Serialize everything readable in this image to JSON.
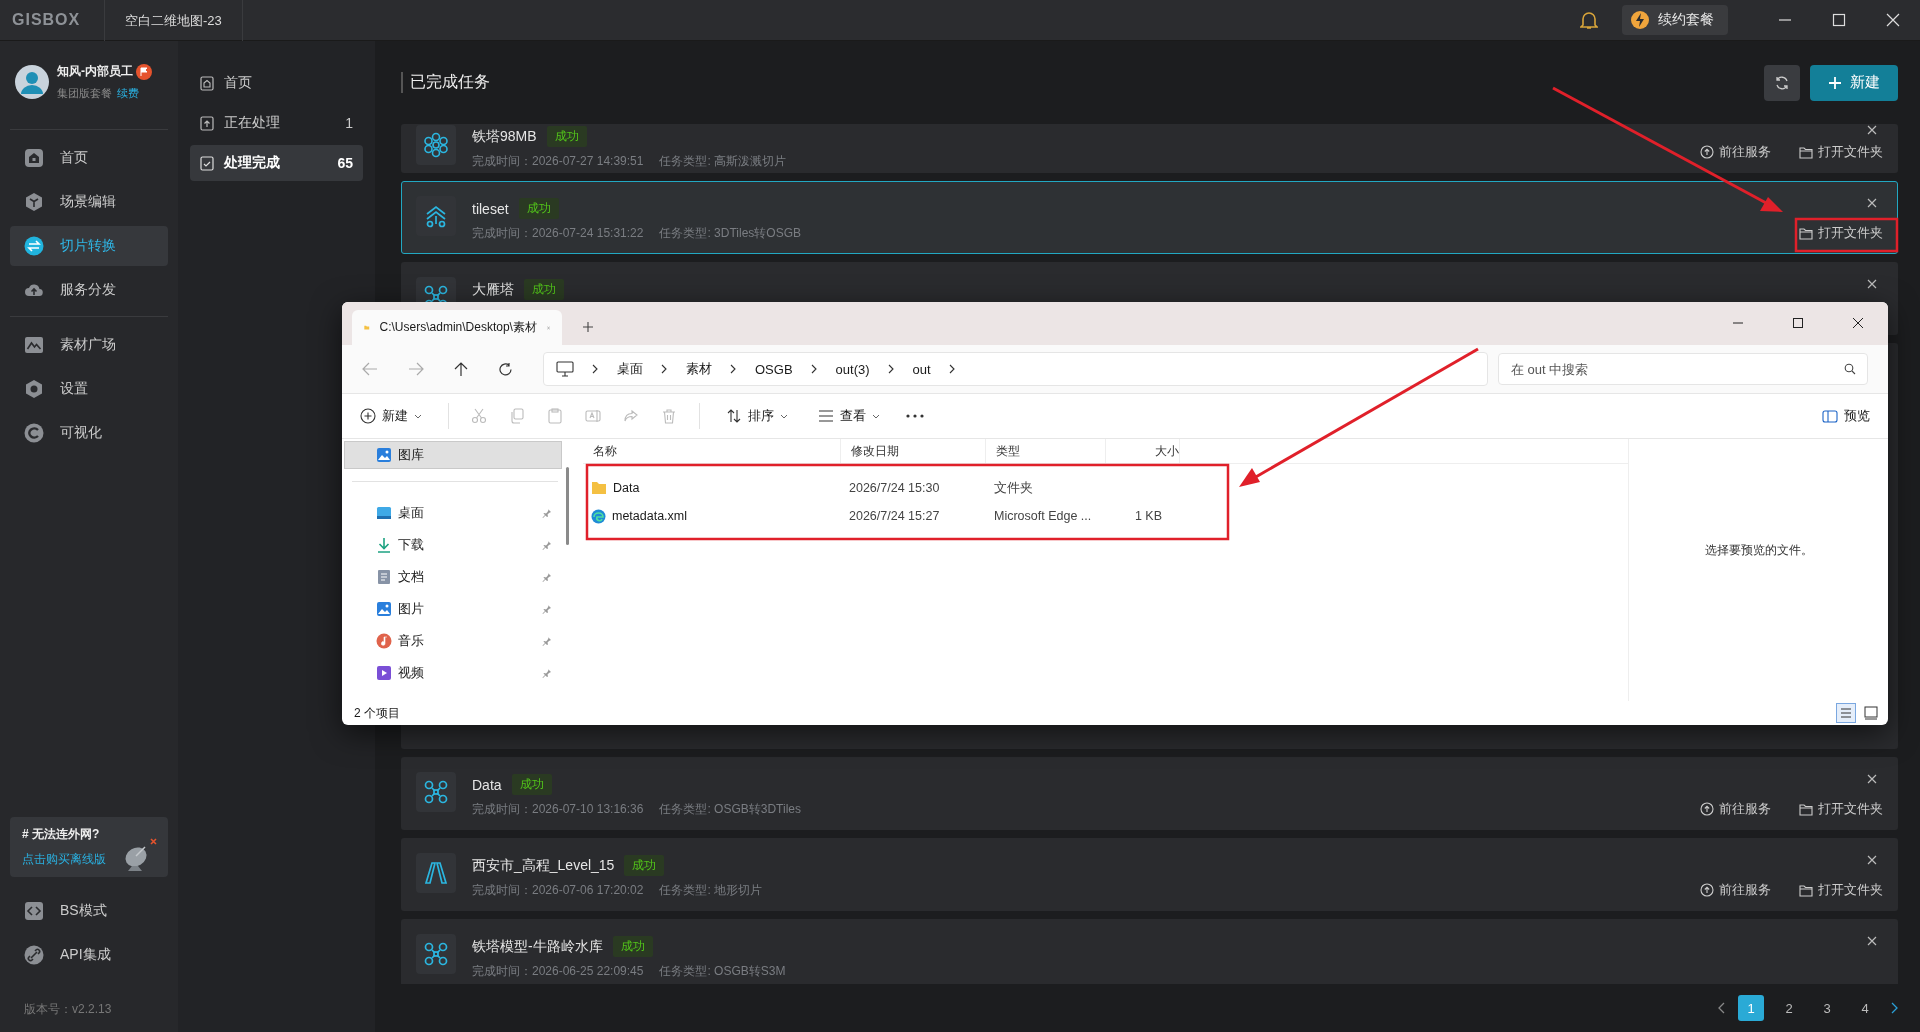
{
  "titlebar": {
    "logo": "GISBOX",
    "project": "空白二维地图-23",
    "renew_button": "续约套餐"
  },
  "user": {
    "name": "知风-内部员工",
    "plan": "集团版套餐",
    "renew_link": "续费"
  },
  "nav_main": [
    {
      "label": "首页",
      "kind": "home",
      "selected": false
    },
    {
      "label": "场景编辑",
      "kind": "cube",
      "selected": false
    },
    {
      "label": "切片转换",
      "kind": "swap",
      "selected": true
    },
    {
      "label": "服务分发",
      "kind": "upload",
      "selected": false
    }
  ],
  "nav_tools": [
    {
      "label": "素材广场",
      "kind": "image",
      "selected": false
    },
    {
      "label": "设置",
      "kind": "gear",
      "selected": false
    },
    {
      "label": "可视化",
      "kind": "visual",
      "selected": false
    }
  ],
  "promo": {
    "title": "# 无法连外网?",
    "link": "点击购买离线版"
  },
  "nav_bottom": [
    {
      "label": "BS模式",
      "kind": "code"
    },
    {
      "label": "API集成",
      "kind": "api"
    }
  ],
  "version": "版本号：v2.2.13",
  "subnav": [
    {
      "label": "首页",
      "kind": "home",
      "selected": false
    },
    {
      "label": "正在处理",
      "kind": "upload",
      "count": "1",
      "selected": false
    },
    {
      "label": "处理完成",
      "kind": "check",
      "count": "65",
      "selected": true
    }
  ],
  "page": {
    "title": "已完成任务",
    "new_button": "新建"
  },
  "tasks_top": [
    {
      "name": "铁塔98MB",
      "status": "成功",
      "time": "完成时间：2026-07-27 14:39:51",
      "type": "任务类型: 高斯泼溅切片",
      "kind": "gauss",
      "selected": false,
      "actions": [
        {
          "label": "前往服务",
          "kind": "service"
        },
        {
          "label": "打开文件夹",
          "kind": "folder"
        }
      ]
    },
    {
      "name": "tileset",
      "status": "成功",
      "time": "完成时间：2026-07-24 15:31:22",
      "type": "任务类型: 3DTiles转OSGB",
      "kind": "tiles",
      "selected": true,
      "actions": [
        {
          "label": "打开文件夹",
          "kind": "folder"
        }
      ]
    },
    {
      "name": "大雁塔",
      "status": "成功",
      "kind": "rotor",
      "selected": false
    }
  ],
  "tasks_bottom": [
    {
      "name": "Data",
      "status": "成功",
      "time": "完成时间：2026-07-10 13:16:36",
      "type": "任务类型: OSGB转3DTiles",
      "kind": "rotor",
      "selected": false,
      "actions": [
        {
          "label": "前往服务",
          "kind": "service"
        },
        {
          "label": "打开文件夹",
          "kind": "folder"
        }
      ]
    },
    {
      "name": "西安市_高程_Level_15",
      "status": "成功",
      "time": "完成时间：2026-07-06 17:20:02",
      "type": "任务类型: 地形切片",
      "kind": "terrain",
      "selected": false,
      "actions": [
        {
          "label": "前往服务",
          "kind": "service"
        },
        {
          "label": "打开文件夹",
          "kind": "folder"
        }
      ]
    },
    {
      "name": "铁塔模型-牛路岭水库",
      "status": "成功",
      "time": "完成时间：2026-06-25 22:09:45",
      "type": "任务类型: OSGB转S3M",
      "kind": "rotor",
      "selected": false
    }
  ],
  "pagination": [
    {
      "label": "1",
      "selected": true
    },
    {
      "label": "2",
      "selected": false
    },
    {
      "label": "3",
      "selected": false
    },
    {
      "label": "4",
      "selected": false
    }
  ],
  "explorer": {
    "tab": "C:\\Users\\admin\\Desktop\\素材",
    "breadcrumb": [
      "桌面",
      "素材",
      "OSGB",
      "out(3)",
      "out"
    ],
    "search_placeholder": "在 out 中搜索",
    "toolbar": {
      "new": "新建",
      "sort": "排序",
      "view": "查看",
      "preview": "预览"
    },
    "nav": [
      {
        "label": "图库",
        "kind": "gallery",
        "selected": true,
        "pinned": false
      },
      {
        "label": "桌面",
        "kind": "desktop",
        "selected": false,
        "pinned": true
      },
      {
        "label": "下载",
        "kind": "download",
        "selected": false,
        "pinned": true
      },
      {
        "label": "文档",
        "kind": "document",
        "selected": false,
        "pinned": true
      },
      {
        "label": "图片",
        "kind": "gallery",
        "selected": false,
        "pinned": true
      },
      {
        "label": "音乐",
        "kind": "music",
        "selected": false,
        "pinned": true
      },
      {
        "label": "视频",
        "kind": "video",
        "selected": false,
        "pinned": true
      }
    ],
    "columns": [
      "名称",
      "修改日期",
      "类型",
      "大小"
    ],
    "files": [
      {
        "name": "Data",
        "kind": "folder",
        "modified": "2026/7/24 15:30",
        "type": "文件夹"
      },
      {
        "name": "metadata.xml",
        "kind": "edge",
        "modified": "2026/7/24 15:27",
        "type": "Microsoft Edge ...",
        "size": "1 KB"
      }
    ],
    "preview_hint": "选择要预览的文件。",
    "status": "2 个项目"
  }
}
